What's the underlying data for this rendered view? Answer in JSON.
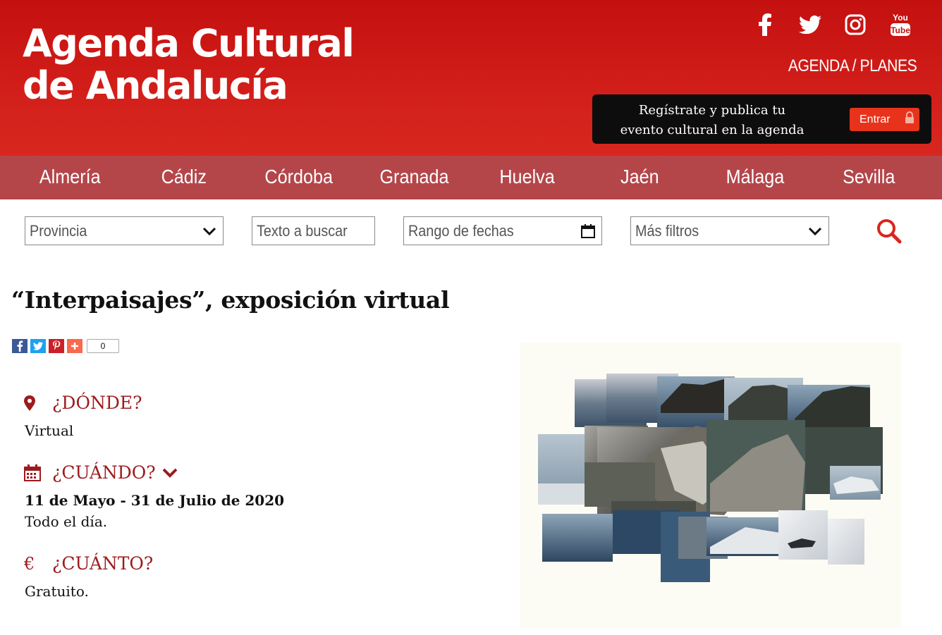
{
  "header": {
    "logo_line1": "Agenda Cultural",
    "logo_line2": "de Andalucía",
    "social": [
      "facebook-icon",
      "twitter-icon",
      "instagram-icon",
      "youtube-icon"
    ],
    "youtube_top": "You",
    "youtube_bottom": "Tube",
    "agenda_link": "AGENDA / PLANES",
    "register_line1": "Regístrate y publica tu",
    "register_line2": "evento cultural en la agenda",
    "enter_label": "Entrar"
  },
  "nav": {
    "items": [
      "Almería",
      "Cádiz",
      "Córdoba",
      "Granada",
      "Huelva",
      "Jaén",
      "Málaga",
      "Sevilla"
    ]
  },
  "filters": {
    "province": "Provincia",
    "text_search": "Texto a buscar",
    "date_range": "Rango de fechas",
    "more_filters": "Más filtros"
  },
  "event": {
    "title": "“Interpaisajes”, exposición virtual",
    "share_count": "0",
    "where_label": "¿DÓNDE?",
    "where_value": "Virtual",
    "when_label": "¿CUÁNDO?",
    "when_dates": "11 de Mayo - 31 de Julio de 2020",
    "when_time": "Todo el día.",
    "price_label": "¿CUÁNTO?",
    "price_symbol": "€",
    "price_value": "Gratuito."
  },
  "colors": {
    "header_red": "#d21f1a",
    "nav_bg": "#b4464a",
    "section_red": "#9c1b1e",
    "button_orange": "#e8331c"
  }
}
